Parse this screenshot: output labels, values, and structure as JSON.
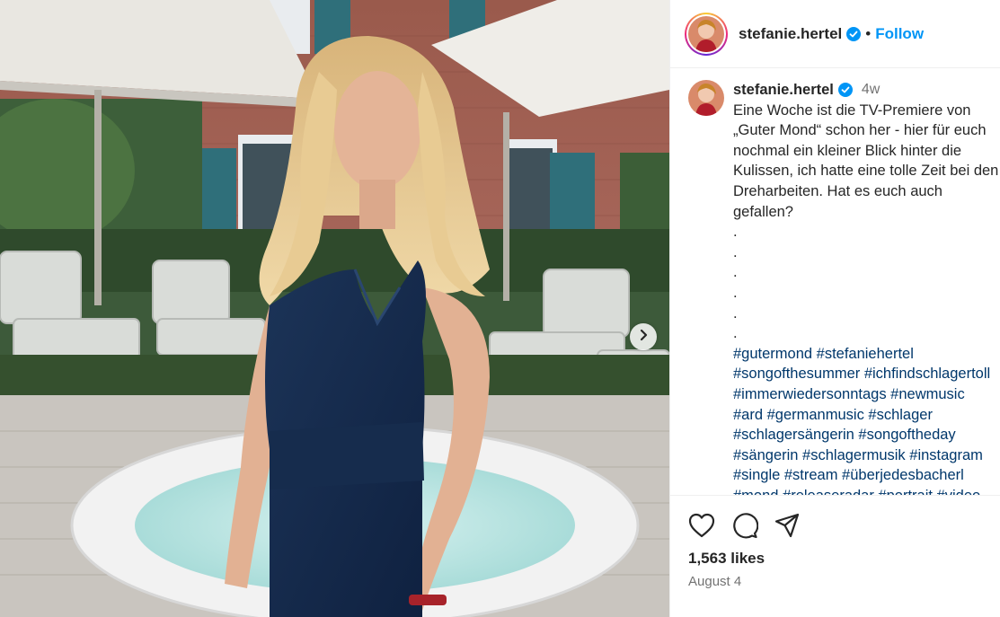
{
  "post": {
    "username": "stefanie.hertel",
    "follow_label": "Follow",
    "separator": "•",
    "time_ago": "4w",
    "caption_lines": [
      "Eine Woche ist die TV-Premiere von",
      "„Guter Mond“ schon her - hier für euch",
      "nochmal ein kleiner Blick hinter die",
      "Kulissen, ich hatte eine tolle Zeit bei den",
      "Dreharbeiten. Hat es euch auch",
      "gefallen?",
      ".",
      ".",
      ".",
      ".",
      ".",
      "."
    ],
    "hashtag_lines": [
      "#gutermond #stefaniehertel",
      "#songofthesummer #ichfindschlagertoll",
      "#immerwiedersonntags #newmusic",
      "#ard #germanmusic #schlager",
      "#schlagersängerin #songoftheday",
      "#sängerin #schlagermusik #instagram",
      "#single #stream #überjedesbacherl",
      "#mond #releaseradar #portrait #video"
    ],
    "likes": "1,563 likes",
    "date": "August 4"
  },
  "icons": {
    "like": "heart-icon",
    "comment": "comment-icon",
    "share": "share-icon",
    "next": "chevron-right-icon",
    "verified": "verified-badge-icon"
  },
  "colors": {
    "accent": "#0095f6",
    "hashtag": "#00376b",
    "verified": "#0095f6",
    "muted": "#737373"
  }
}
